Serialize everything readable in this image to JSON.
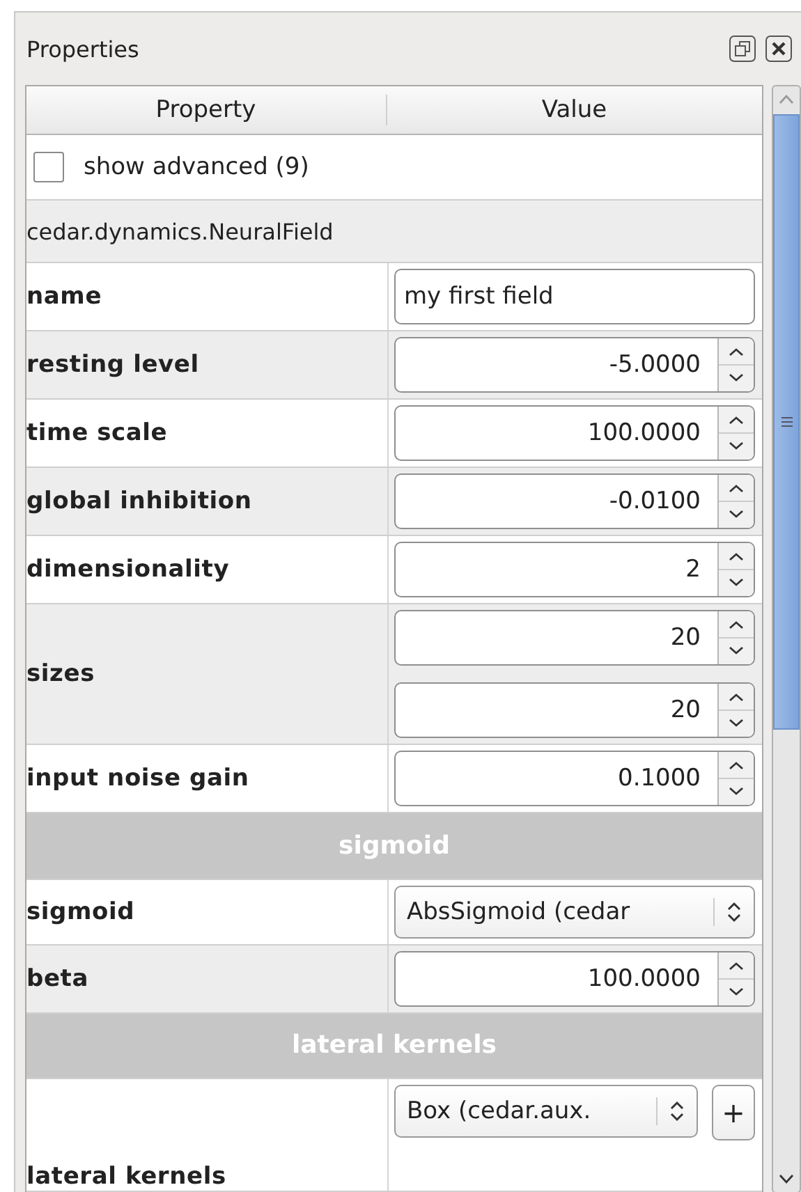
{
  "panel": {
    "title": "Properties"
  },
  "table": {
    "columns": [
      "Property",
      "Value"
    ],
    "advanced": {
      "label": "show advanced (9)",
      "checked": false
    },
    "class_name": "cedar.dynamics.NeuralField",
    "rows": [
      {
        "kind": "text",
        "label": "name",
        "values": [
          "my first field"
        ]
      },
      {
        "kind": "spin",
        "label": "resting level",
        "values": [
          "-5.0000"
        ]
      },
      {
        "kind": "spin",
        "label": "time scale",
        "values": [
          "100.0000"
        ]
      },
      {
        "kind": "spin",
        "label": "global inhibition",
        "values": [
          "-0.0100"
        ]
      },
      {
        "kind": "spin",
        "label": "dimensionality",
        "values": [
          "2"
        ]
      },
      {
        "kind": "spin",
        "label": "sizes",
        "values": [
          "20",
          "20"
        ]
      },
      {
        "kind": "spin",
        "label": "input noise gain",
        "values": [
          "0.1000"
        ]
      },
      {
        "kind": "section",
        "label": "sigmoid"
      },
      {
        "kind": "select",
        "label": "sigmoid",
        "values": [
          "AbsSigmoid (cedar"
        ]
      },
      {
        "kind": "spin",
        "label": "beta",
        "values": [
          "100.0000"
        ]
      },
      {
        "kind": "section",
        "label": "lateral kernels"
      },
      {
        "kind": "select_add",
        "label": "lateral kernels",
        "values": [
          "Box (cedar.aux."
        ],
        "button": "+"
      }
    ]
  }
}
